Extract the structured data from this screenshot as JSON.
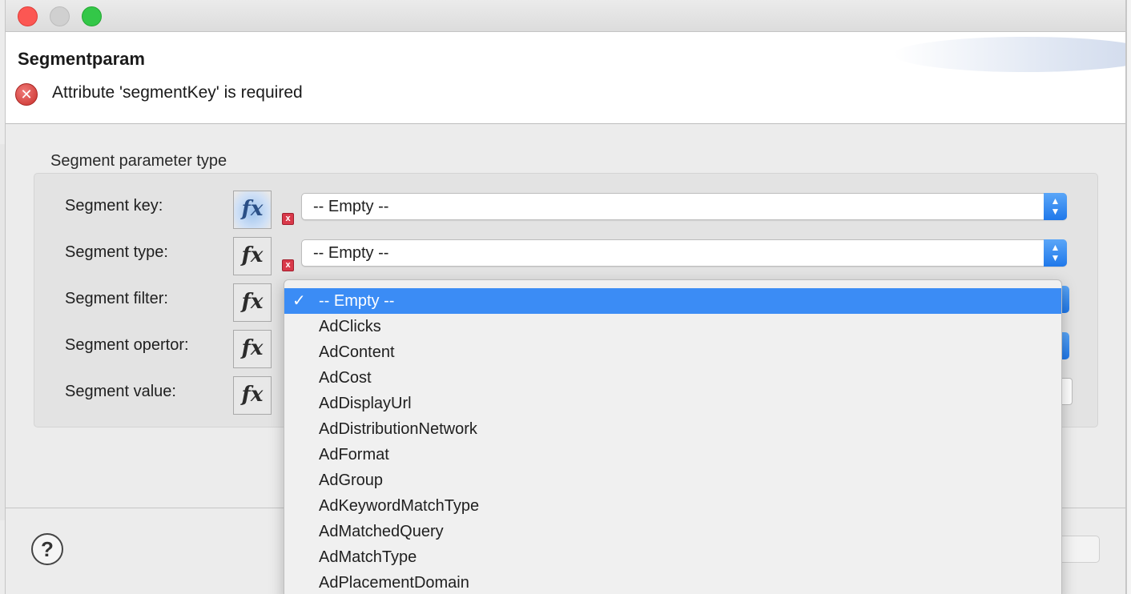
{
  "window": {
    "title": "Segmentparam"
  },
  "header": {
    "title": "Segmentparam",
    "error_message": "Attribute 'segmentKey' is required"
  },
  "group": {
    "title": "Segment parameter type"
  },
  "rows": [
    {
      "label": "Segment key:",
      "value": "-- Empty --"
    },
    {
      "label": "Segment type:",
      "value": "-- Empty --"
    },
    {
      "label": "Segment filter:",
      "value": "-- Empty --"
    },
    {
      "label": "Segment opertor:",
      "value": ""
    },
    {
      "label": "Segment value:",
      "value": ""
    }
  ],
  "fx_label": "fx",
  "error_mark": "x",
  "dropdown": {
    "check": "✓",
    "items": [
      "-- Empty --",
      "AdClicks",
      "AdContent",
      "AdCost",
      "AdDisplayUrl",
      "AdDistributionNetwork",
      "AdFormat",
      "AdGroup",
      "AdKeywordMatchType",
      "AdMatchedQuery",
      "AdMatchType",
      "AdPlacementDomain"
    ],
    "selected_index": 0
  },
  "help": {
    "label": "?"
  },
  "colors": {
    "accent": "#3b8cf5",
    "error": "#d9394a",
    "close_light": "#fc5753",
    "max_light": "#33c748"
  }
}
